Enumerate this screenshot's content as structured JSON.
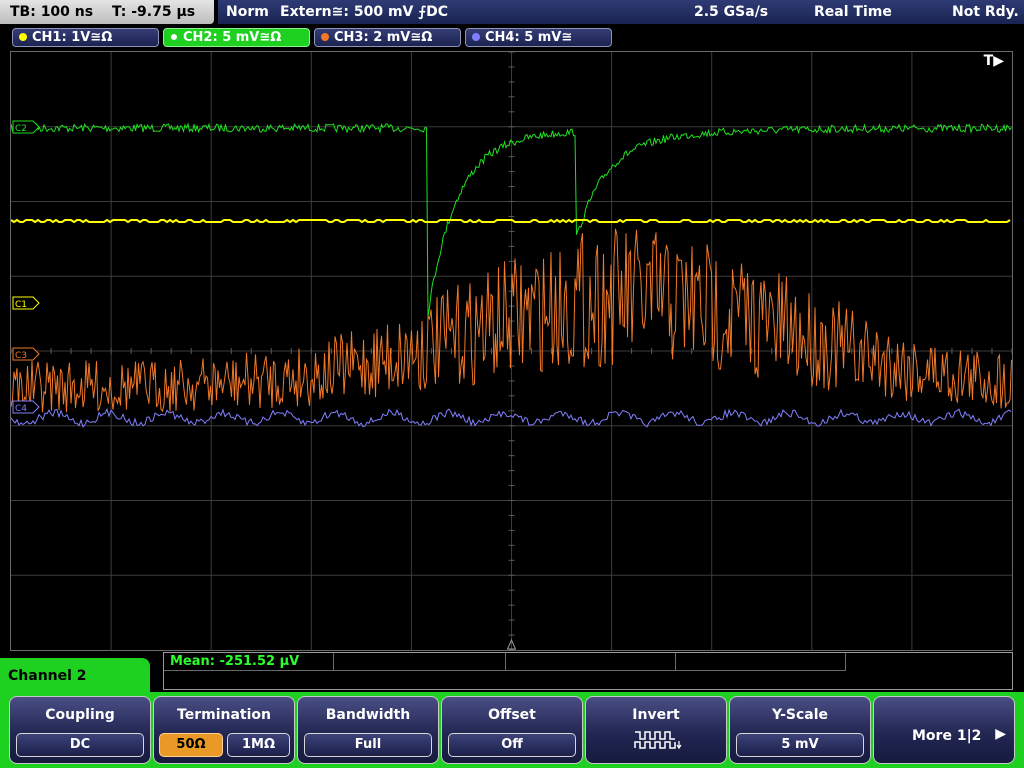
{
  "status_bar": {
    "timebase": "TB: 100 ns",
    "trigger_time": "T: -9.75 µs",
    "trigger_mode": "Norm",
    "trigger_source": "Extern≅: 500 mV ⨍DC",
    "sample_rate": "2.5 GSa/s",
    "acquisition_mode": "Real Time",
    "trigger_state": "Not Rdy."
  },
  "channels": [
    {
      "label": "CH1: 1V≅Ω",
      "color": "#ffff00",
      "active": false
    },
    {
      "label": "CH2: 5 mV≅Ω",
      "color": "#20e020",
      "active": true
    },
    {
      "label": "CH3: 2 mV≅Ω",
      "color": "#f07828",
      "active": false
    },
    {
      "label": "CH4: 5 mV≅",
      "color": "#8080ff",
      "active": false
    }
  ],
  "screen": {
    "trigger_position_marker": "T▶",
    "markers": {
      "c1": "C1",
      "c2": "C2",
      "c3": "C3",
      "c4": "C4"
    }
  },
  "measurement": {
    "mean": "Mean: -251.52 µV"
  },
  "menu": {
    "title": "Channel 2",
    "softkeys": {
      "coupling": {
        "title": "Coupling",
        "value": "DC"
      },
      "termination": {
        "title": "Termination",
        "option_50": "50Ω",
        "option_1m": "1MΩ",
        "selected": "50Ω"
      },
      "bandwidth": {
        "title": "Bandwidth",
        "value": "Full"
      },
      "offset": {
        "title": "Offset",
        "value": "Off"
      },
      "invert": {
        "title": "Invert"
      },
      "yscale": {
        "title": "Y-Scale",
        "value": "5 mV"
      },
      "more": {
        "label": "More 1|2"
      }
    }
  },
  "colors": {
    "ch1": "#ffff00",
    "ch2": "#20e020",
    "ch3": "#f07828",
    "ch4": "#8080ff",
    "menu_accent": "#1ed020",
    "selection": "#e99a26",
    "grid": "#3c3c3c"
  }
}
